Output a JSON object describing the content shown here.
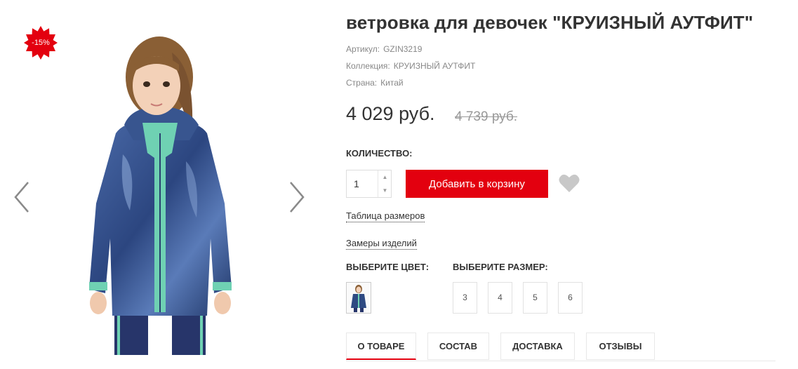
{
  "gallery": {
    "discount_badge": "-15%",
    "prev_icon": "chevron-left-icon",
    "next_icon": "chevron-right-icon"
  },
  "product": {
    "title": "ветровка для девочек \"КРУИЗНЫЙ АУТФИТ\"",
    "meta": [
      {
        "label": "Артикул:",
        "value": "GZIN3219"
      },
      {
        "label": "Коллекция:",
        "value": "КРУИЗНЫЙ АУТФИТ"
      },
      {
        "label": "Страна:",
        "value": "Китай"
      }
    ],
    "price": "4 029 руб.",
    "old_price": "4 739 руб."
  },
  "purchase": {
    "quantity_label": "КОЛИЧЕСТВО:",
    "quantity_value": "1",
    "add_to_cart_label": "Добавить в корзину",
    "wishlist_icon": "heart-icon"
  },
  "links": {
    "size_table": "Таблица размеров",
    "measurements": "Замеры изделий"
  },
  "options": {
    "color_label": "ВЫБЕРИТЕ ЦВЕТ:",
    "size_label": "ВЫБЕРИТЕ РАЗМЕР:",
    "sizes": [
      "3",
      "4",
      "5",
      "6"
    ]
  },
  "tabs": [
    {
      "label": "О ТОВАРЕ",
      "active": true
    },
    {
      "label": "СОСТАВ",
      "active": false
    },
    {
      "label": "ДОСТАВКА",
      "active": false
    },
    {
      "label": "ОТЗЫВЫ",
      "active": false
    }
  ],
  "colors": {
    "accent": "#e3000f",
    "jacket": "#2e4a82",
    "mint": "#6fd1b3"
  }
}
